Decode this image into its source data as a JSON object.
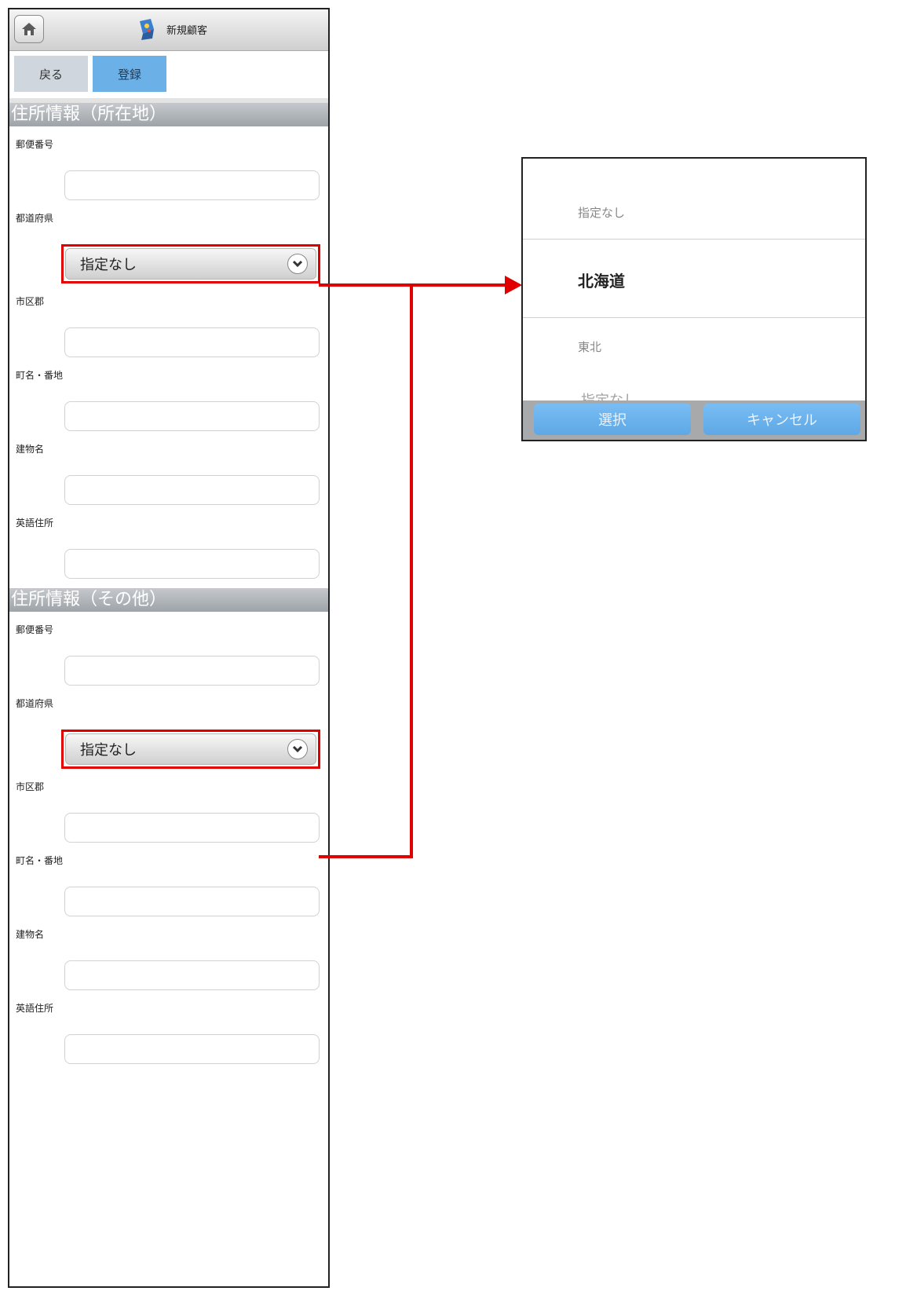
{
  "header": {
    "title": "新規顧客",
    "home_icon": "home-icon"
  },
  "toolbar": {
    "back_label": "戻る",
    "register_label": "登録"
  },
  "sections": [
    {
      "heading": "住所情報（所在地）",
      "postal_label": "郵便番号",
      "prefecture_label": "都道府県",
      "prefecture_value": "指定なし",
      "city_label": "市区郡",
      "street_label": "町名・番地",
      "building_label": "建物名",
      "english_label": "英語住所"
    },
    {
      "heading": "住所情報（その他）",
      "postal_label": "郵便番号",
      "prefecture_label": "都道府県",
      "prefecture_value": "指定なし",
      "city_label": "市区郡",
      "street_label": "町名・番地",
      "building_label": "建物名",
      "english_label": "英語住所"
    }
  ],
  "picker": {
    "options": [
      "指定なし",
      "北海道",
      "東北"
    ],
    "selected": "北海道",
    "behind_text": "指定なし",
    "select_label": "選択",
    "cancel_label": "キャンセル"
  },
  "colors": {
    "highlight": "#e00000",
    "primary_button": "#6cb0e8",
    "section_bar": "#a9aeb3"
  }
}
